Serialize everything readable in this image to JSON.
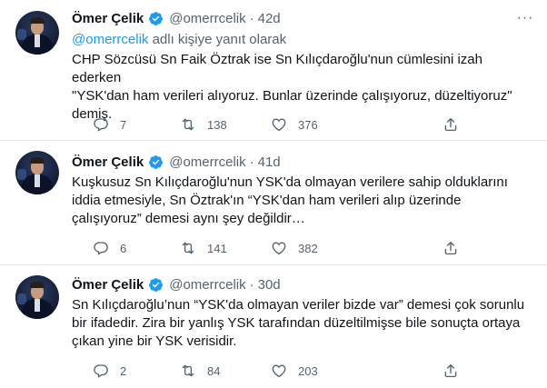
{
  "icons": {
    "verified": "verified-badge-icon",
    "more": "more-options-icon",
    "reply": "reply-icon",
    "retweet": "retweet-icon",
    "like": "like-icon",
    "share": "share-icon"
  },
  "colors": {
    "accent": "#1d9bf0",
    "secondary_text": "#536471",
    "primary_text": "#0f1419",
    "divider": "#e6ecf0"
  },
  "tweets": [
    {
      "name": "Ömer Çelik",
      "handle": "@omerrcelik",
      "dot": "·",
      "time": "42d",
      "more": "···",
      "reply_link": "@omerrcelik",
      "reply_suffix": " adlı kişiye yanıt olarak",
      "text": "CHP Sözcüsü Sn Faik Öztrak ise Sn Kılıçdaroğlu'nun cümlesini izah ederken\n\"YSK'dan ham verileri alıyoruz. Bunlar üzerinde çalışıyoruz, düzeltiyoruz\"\ndemiş.",
      "replies": "7",
      "retweets": "138",
      "likes": "376"
    },
    {
      "name": "Ömer Çelik",
      "handle": "@omerrcelik",
      "dot": "·",
      "time": "41d",
      "text": "Kuşkusuz Sn Kılıçdaroğlu'nun YSK'da olmayan verilere sahip olduklarını\niddia etmesiyle, Sn Öztrak'ın “YSK'dan ham verileri alıp üzerinde\nçalışıyoruz” demesi aynı şey değildir…",
      "replies": "6",
      "retweets": "141",
      "likes": "382"
    },
    {
      "name": "Ömer Çelik",
      "handle": "@omerrcelik",
      "dot": "·",
      "time": "30d",
      "text": "Sn Kılıçdaroğlu’nun “YSK'da olmayan veriler bizde var” demesi çok sorunlu\nbir ifadedir. Zira bir yanlış YSK tarafından düzeltilmişse bile sonuçta ortaya\nçıkan yine bir YSK verisidir.",
      "replies": "2",
      "retweets": "84",
      "likes": "203"
    }
  ]
}
